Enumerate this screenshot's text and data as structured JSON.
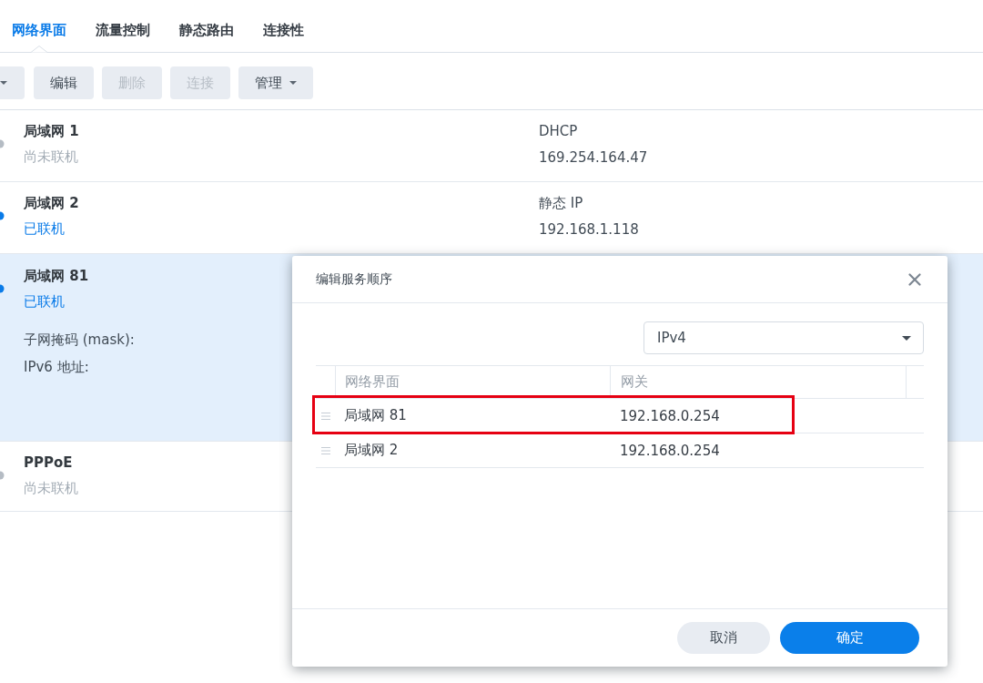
{
  "tabs": [
    {
      "label": "网络界面",
      "selected": true
    },
    {
      "label": "流量控制",
      "selected": false
    },
    {
      "label": "静态路由",
      "selected": false
    },
    {
      "label": "连接性",
      "selected": false
    }
  ],
  "toolbar": [
    {
      "kind": "menu",
      "disabled": false
    },
    {
      "kind": "button",
      "label": "编辑",
      "disabled": false
    },
    {
      "kind": "button",
      "label": "删除",
      "disabled": true
    },
    {
      "kind": "button",
      "label": "连接",
      "disabled": true
    },
    {
      "kind": "menu",
      "label": "管理",
      "disabled": false
    }
  ],
  "interfaces": [
    {
      "name": "局域网 1",
      "status": "尚未联机",
      "connected": false,
      "selected": false,
      "type": "DHCP",
      "address": "169.254.164.47"
    },
    {
      "name": "局域网 2",
      "status": "已联机",
      "connected": true,
      "selected": false,
      "type": "静态 IP",
      "address": "192.168.1.118"
    },
    {
      "name": "局域网 81",
      "status": "已联机",
      "connected": true,
      "selected": true,
      "details": [
        "子网掩码 (mask):",
        "IPv6 地址:"
      ]
    },
    {
      "name": "PPPoE",
      "status": "尚未联机",
      "connected": false,
      "selected": false
    }
  ],
  "dialog": {
    "title": "编辑服务顺序",
    "protocol": "IPv4",
    "table": {
      "columns": [
        "网络界面",
        "网关"
      ],
      "rows": [
        {
          "interface": "局域网 81",
          "gateway": "192.168.0.254",
          "highlighted": true
        },
        {
          "interface": "局域网 2",
          "gateway": "192.168.0.254",
          "highlighted": false
        }
      ]
    },
    "buttons": [
      {
        "label": "取消",
        "kind": "secondary"
      },
      {
        "label": "确定",
        "kind": "primary"
      }
    ]
  }
}
